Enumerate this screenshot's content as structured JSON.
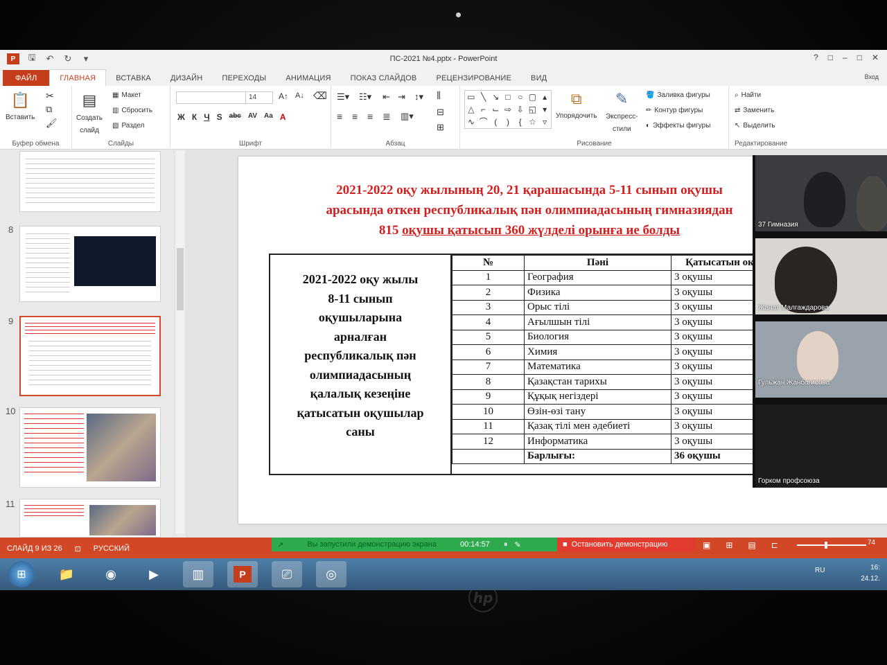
{
  "window": {
    "title": "ПС-2021 №4.pptx - PowerPoint",
    "controls": [
      "?",
      "□",
      "–",
      "□",
      "✕"
    ]
  },
  "qat": {
    "app_badge": "P",
    "icons": [
      "save-icon",
      "undo-icon",
      "redo-icon",
      "customize-icon"
    ]
  },
  "tabs": [
    {
      "label": "ФАЙЛ",
      "kind": "file"
    },
    {
      "label": "ГЛАВНАЯ",
      "kind": "active"
    },
    {
      "label": "ВСТАВКА",
      "kind": ""
    },
    {
      "label": "ДИЗАЙН",
      "kind": ""
    },
    {
      "label": "ПЕРЕХОДЫ",
      "kind": ""
    },
    {
      "label": "АНИМАЦИЯ",
      "kind": ""
    },
    {
      "label": "ПОКАЗ СЛАЙДОВ",
      "kind": ""
    },
    {
      "label": "РЕЦЕНЗИРОВАНИЕ",
      "kind": ""
    },
    {
      "label": "ВИД",
      "kind": ""
    }
  ],
  "ribbon": {
    "signin": "Вход",
    "clipboard": {
      "label": "Буфер обмена",
      "paste": "Вставить"
    },
    "slides": {
      "label": "Слайды",
      "new_slide_line1": "Создать",
      "new_slide_line2": "слайд",
      "layout": "Макет",
      "reset": "Сбросить",
      "section": "Раздел"
    },
    "font": {
      "label": "Шрифт",
      "name": "",
      "size": "14",
      "bold": "Ж",
      "italic": "К",
      "underline": "Ч",
      "shadow": "S",
      "strike": "abc",
      "spacing": "AV",
      "case": "Aa",
      "color": "A"
    },
    "paragraph": {
      "label": "Абзац"
    },
    "drawing": {
      "label": "Рисование",
      "arrange": "Упорядочить",
      "quick_styles_line1": "Экспресс-",
      "quick_styles_line2": "стили",
      "fill": "Заливка фигуры",
      "outline": "Контур фигуры",
      "effects": "Эффекты фигуры"
    },
    "editing": {
      "label": "Редактирование",
      "find": "Найти",
      "replace": "Заменить",
      "select": "Выделить"
    }
  },
  "thumbnails": {
    "numbers": [
      "8",
      "9",
      "10",
      "11"
    ]
  },
  "slide": {
    "title_line1": "2021-2022 оқу жылының 20, 21 қарашасында 5-11 сынып оқушы",
    "title_line2": "арасында өткен республикалық пән олимпиадасының гимназиядан",
    "title_line3_plain": "815 ",
    "title_line3_underlined": "оқушы қатысып 360 жүлделі орынға ие болды",
    "side_text": [
      "2021-2022 оқу жылы",
      "8-11 сынып",
      "оқушыларына",
      "арналған",
      "республикалық пән",
      "олимпиадасының",
      "қалалық кезеңіне",
      "қатысатын оқушылар",
      "саны"
    ],
    "table": {
      "headers": [
        "№",
        "Пәні",
        "Қатысатын оқ"
      ],
      "rows": [
        {
          "n": "1",
          "subject": "География",
          "count": "3 оқушы"
        },
        {
          "n": "2",
          "subject": "Физика",
          "count": "3 оқушы"
        },
        {
          "n": "3",
          "subject": "Орыс тілі",
          "count": "3 оқушы"
        },
        {
          "n": "4",
          "subject": "Ағылшын тілі",
          "count": "3 оқушы"
        },
        {
          "n": "5",
          "subject": "Биология",
          "count": "3 оқушы"
        },
        {
          "n": "6",
          "subject": "Химия",
          "count": "3 оқушы"
        },
        {
          "n": "7",
          "subject": "Математика",
          "count": "3 оқушы"
        },
        {
          "n": "8",
          "subject": "Қазақстан тарихы",
          "count": "3 оқушы"
        },
        {
          "n": "9",
          "subject": "Құқық негіздері",
          "count": "3 оқушы"
        },
        {
          "n": "10",
          "subject": "Өзін-өзі тану",
          "count": "3 оқушы"
        },
        {
          "n": "11",
          "subject": "Қазақ тілі мен әдебиеті",
          "count": "3 оқушы"
        },
        {
          "n": "12",
          "subject": "Информатика",
          "count": "3 оқушы"
        }
      ],
      "total_label": "Барлығы:",
      "total_value": "36 оқушы"
    }
  },
  "video_call": {
    "participants": [
      "37 Гимназия",
      "Жанат Малгаждарова",
      "Гульжан Жанбагисова",
      "Горком профсоюза"
    ]
  },
  "status": {
    "slide_counter": "СЛАЙД 9 ИЗ 26",
    "language": "РУССКИЙ",
    "share_message": "Вы запустили демонстрацию экрана",
    "share_timer": "00:14:57",
    "stop_share": "Остановить демонстрацию",
    "zoom": "74"
  },
  "taskbar": {
    "lang": "RU",
    "time": "16:",
    "date": "24.12."
  },
  "colors": {
    "accent": "#d24726",
    "slide_title": "#d21f1f",
    "share_green": "#2eaa4f",
    "share_red": "#e23b2f"
  }
}
